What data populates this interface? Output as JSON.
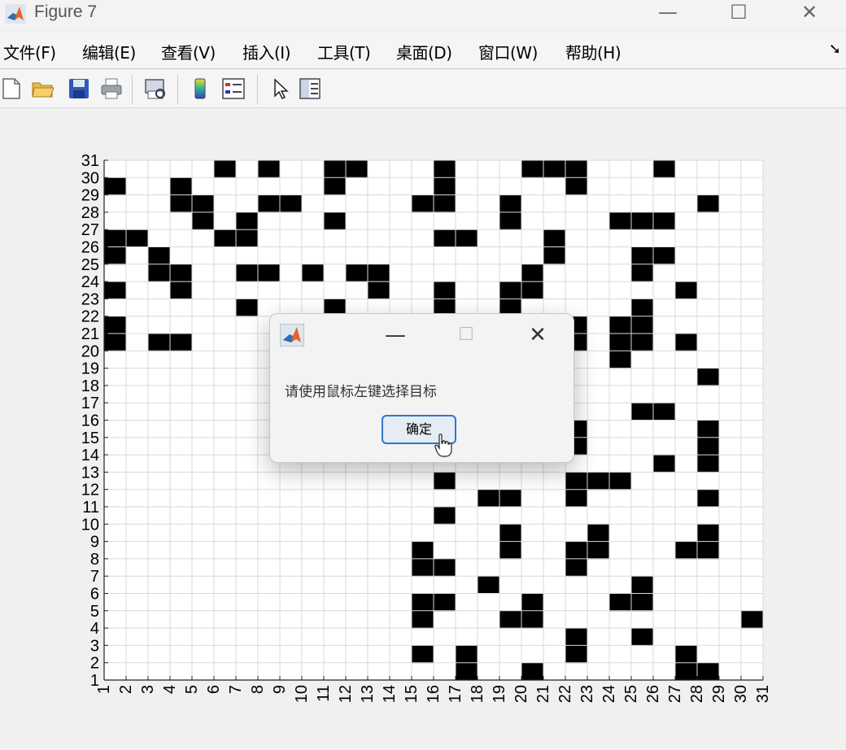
{
  "window": {
    "title": "Figure 7"
  },
  "menu": {
    "items": [
      "文件(F)",
      "编辑(E)",
      "查看(V)",
      "插入(I)",
      "工具(T)",
      "桌面(D)",
      "窗口(W)",
      "帮助(H)"
    ]
  },
  "toolbar": {
    "icons": [
      "new-file-icon",
      "open-folder-icon",
      "save-icon",
      "print-icon",
      "print-preview-icon",
      "colorbar-icon",
      "legend-icon",
      "pointer-icon",
      "property-inspector-icon"
    ]
  },
  "chart_data": {
    "type": "heatmap",
    "x_ticks": [
      1,
      2,
      3,
      4,
      5,
      6,
      7,
      8,
      9,
      10,
      11,
      12,
      13,
      14,
      15,
      16,
      17,
      18,
      19,
      20,
      21,
      22,
      23,
      24,
      25,
      26,
      27,
      28,
      29,
      30,
      31
    ],
    "y_ticks": [
      1,
      2,
      3,
      4,
      5,
      6,
      7,
      8,
      9,
      10,
      11,
      12,
      13,
      14,
      15,
      16,
      17,
      18,
      19,
      20,
      21,
      22,
      23,
      24,
      25,
      26,
      27,
      28,
      29,
      30,
      31
    ],
    "xlim": [
      1,
      31
    ],
    "ylim": [
      1,
      31
    ],
    "grid": true,
    "cell_colors": {
      "filled": "#000000",
      "empty": "#ffffff"
    },
    "obstacles": [
      [
        6,
        30
      ],
      [
        8,
        30
      ],
      [
        11,
        30
      ],
      [
        12,
        30
      ],
      [
        16,
        30
      ],
      [
        20,
        30
      ],
      [
        21,
        30
      ],
      [
        22,
        30
      ],
      [
        26,
        30
      ],
      [
        1,
        29
      ],
      [
        4,
        29
      ],
      [
        11,
        29
      ],
      [
        16,
        29
      ],
      [
        22,
        29
      ],
      [
        4,
        28
      ],
      [
        5,
        28
      ],
      [
        8,
        28
      ],
      [
        9,
        28
      ],
      [
        15,
        28
      ],
      [
        16,
        28
      ],
      [
        19,
        28
      ],
      [
        28,
        28
      ],
      [
        5,
        27
      ],
      [
        7,
        27
      ],
      [
        11,
        27
      ],
      [
        19,
        27
      ],
      [
        24,
        27
      ],
      [
        25,
        27
      ],
      [
        26,
        27
      ],
      [
        1,
        26
      ],
      [
        2,
        26
      ],
      [
        6,
        26
      ],
      [
        7,
        26
      ],
      [
        16,
        26
      ],
      [
        17,
        26
      ],
      [
        21,
        26
      ],
      [
        1,
        25
      ],
      [
        3,
        25
      ],
      [
        21,
        25
      ],
      [
        25,
        25
      ],
      [
        26,
        25
      ],
      [
        3,
        24
      ],
      [
        4,
        24
      ],
      [
        7,
        24
      ],
      [
        8,
        24
      ],
      [
        10,
        24
      ],
      [
        12,
        24
      ],
      [
        13,
        24
      ],
      [
        20,
        24
      ],
      [
        25,
        24
      ],
      [
        1,
        23
      ],
      [
        4,
        23
      ],
      [
        13,
        23
      ],
      [
        16,
        23
      ],
      [
        19,
        23
      ],
      [
        20,
        23
      ],
      [
        27,
        23
      ],
      [
        7,
        22
      ],
      [
        11,
        22
      ],
      [
        16,
        22
      ],
      [
        19,
        22
      ],
      [
        25,
        22
      ],
      [
        1,
        21
      ],
      [
        22,
        21
      ],
      [
        24,
        21
      ],
      [
        25,
        21
      ],
      [
        1,
        20
      ],
      [
        3,
        20
      ],
      [
        4,
        20
      ],
      [
        22,
        20
      ],
      [
        24,
        20
      ],
      [
        25,
        20
      ],
      [
        27,
        20
      ],
      [
        24,
        19
      ],
      [
        28,
        18
      ],
      [
        25,
        16
      ],
      [
        26,
        16
      ],
      [
        22,
        15
      ],
      [
        28,
        15
      ],
      [
        22,
        14
      ],
      [
        28,
        14
      ],
      [
        26,
        13
      ],
      [
        28,
        13
      ],
      [
        16,
        12
      ],
      [
        22,
        12
      ],
      [
        23,
        12
      ],
      [
        24,
        12
      ],
      [
        18,
        11
      ],
      [
        19,
        11
      ],
      [
        22,
        11
      ],
      [
        28,
        11
      ],
      [
        16,
        10
      ],
      [
        19,
        9
      ],
      [
        23,
        9
      ],
      [
        28,
        9
      ],
      [
        15,
        8
      ],
      [
        19,
        8
      ],
      [
        22,
        8
      ],
      [
        23,
        8
      ],
      [
        27,
        8
      ],
      [
        28,
        8
      ],
      [
        15,
        7
      ],
      [
        16,
        7
      ],
      [
        22,
        7
      ],
      [
        18,
        6
      ],
      [
        25,
        6
      ],
      [
        15,
        5
      ],
      [
        16,
        5
      ],
      [
        20,
        5
      ],
      [
        24,
        5
      ],
      [
        25,
        5
      ],
      [
        15,
        4
      ],
      [
        19,
        4
      ],
      [
        20,
        4
      ],
      [
        30,
        4
      ],
      [
        22,
        3
      ],
      [
        25,
        3
      ],
      [
        15,
        2
      ],
      [
        17,
        2
      ],
      [
        22,
        2
      ],
      [
        27,
        2
      ],
      [
        17,
        1
      ],
      [
        20,
        1
      ],
      [
        27,
        1
      ],
      [
        28,
        1
      ]
    ]
  },
  "dialog": {
    "message": "请使用鼠标左键选择目标",
    "ok_label": "确定",
    "minimize_glyph": "—",
    "close_glyph": "✕"
  }
}
